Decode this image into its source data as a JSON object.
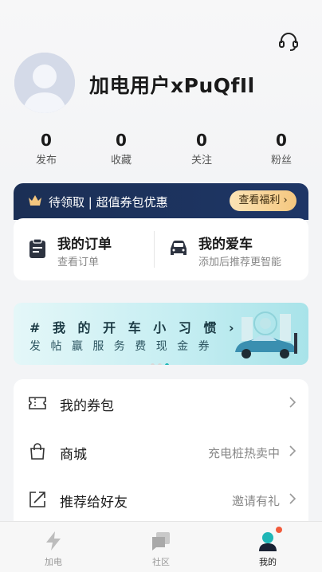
{
  "header": {
    "username": "加电用户xPuQfIl",
    "support_icon": "headset-icon"
  },
  "stats": [
    {
      "value": "0",
      "label": "发布"
    },
    {
      "value": "0",
      "label": "收藏"
    },
    {
      "value": "0",
      "label": "关注"
    },
    {
      "value": "0",
      "label": "粉丝"
    }
  ],
  "benefit": {
    "text": "待领取 | 超值券包优惠",
    "button": "查看福利",
    "bg_color": "#1b2f55",
    "accent": "#f4c77f"
  },
  "orders": [
    {
      "title": "我的订单",
      "subtitle": "查看订单",
      "icon": "clipboard-icon"
    },
    {
      "title": "我的爱车",
      "subtitle": "添加后推荐更智能",
      "icon": "car-icon"
    }
  ],
  "banner": {
    "title": "# 我 的 开 车 小 习 惯",
    "subtitle": "发 帖 赢 服 务 费 现 金 券",
    "active_dot": 2,
    "dot_count": 3
  },
  "menu": [
    {
      "label": "我的券包",
      "hint": "",
      "icon": "ticket-icon"
    },
    {
      "label": "商城",
      "hint": "充电桩热卖中",
      "icon": "shopping-bag-icon"
    },
    {
      "label": "推荐给好友",
      "hint": "邀请有礼",
      "icon": "share-icon"
    }
  ],
  "tabbar": [
    {
      "label": "加电",
      "icon": "lightning-icon",
      "active": false
    },
    {
      "label": "社区",
      "icon": "chat-cards-icon",
      "active": false
    },
    {
      "label": "我的",
      "icon": "profile-icon",
      "active": true,
      "badge": true
    }
  ],
  "colors": {
    "primary_teal": "#1fb6b6",
    "badge_red": "#f25a3a"
  }
}
